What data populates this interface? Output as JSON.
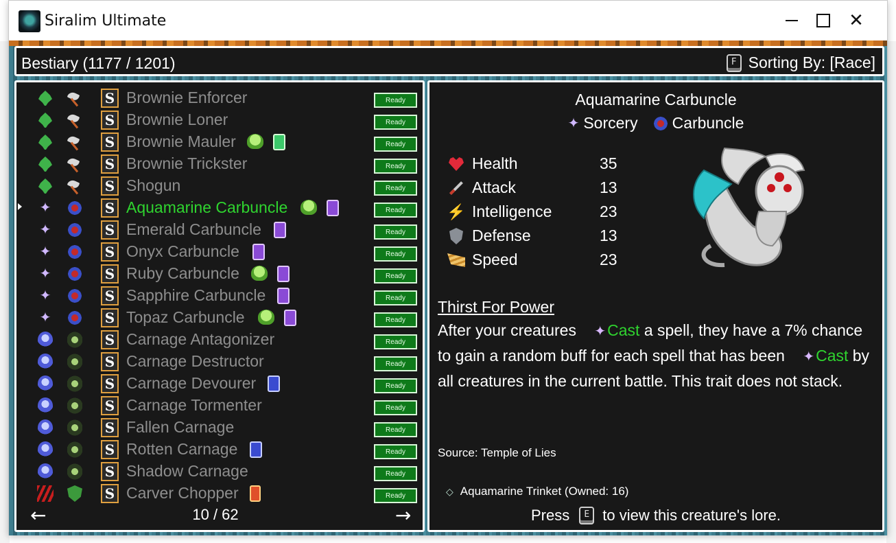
{
  "window": {
    "title": "Siralim Ultimate",
    "controls": {
      "minimize": "—",
      "maximize": "□",
      "close": "✕"
    }
  },
  "header": {
    "title": "Bestiary (1177 / 1201)",
    "sort_key": "F",
    "sort_label": "Sorting By: [Race]"
  },
  "list": {
    "status_label": "Ready",
    "selected_index": 5,
    "rows": [
      {
        "name": "Brownie Enforcer",
        "race_icon": "leaf-icon",
        "class_icon": "axe-icon",
        "extras": []
      },
      {
        "name": "Brownie Loner",
        "race_icon": "leaf-icon",
        "class_icon": "axe-icon",
        "extras": []
      },
      {
        "name": "Brownie Mauler",
        "race_icon": "leaf-icon",
        "class_icon": "axe-icon",
        "extras": [
          "blob-green-icon",
          "card-green-icon"
        ]
      },
      {
        "name": "Brownie Trickster",
        "race_icon": "leaf-icon",
        "class_icon": "axe-icon",
        "extras": []
      },
      {
        "name": "Shogun",
        "race_icon": "leaf-icon",
        "class_icon": "axe-icon",
        "extras": []
      },
      {
        "name": "Aquamarine Carbuncle",
        "race_icon": "sparkle-icon",
        "class_icon": "carbuncle-icon",
        "extras": [
          "blob-green-icon",
          "card-purple-icon"
        ]
      },
      {
        "name": "Emerald Carbuncle",
        "race_icon": "sparkle-icon",
        "class_icon": "carbuncle-icon",
        "extras": [
          "card-purple-icon"
        ]
      },
      {
        "name": "Onyx Carbuncle",
        "race_icon": "sparkle-icon",
        "class_icon": "carbuncle-icon",
        "extras": [
          "card-purple-icon"
        ]
      },
      {
        "name": "Ruby Carbuncle",
        "race_icon": "sparkle-icon",
        "class_icon": "carbuncle-icon",
        "extras": [
          "blob-green-icon",
          "card-purple-icon"
        ]
      },
      {
        "name": "Sapphire Carbuncle",
        "race_icon": "sparkle-icon",
        "class_icon": "carbuncle-icon",
        "extras": [
          "card-purple-icon"
        ]
      },
      {
        "name": "Topaz Carbuncle",
        "race_icon": "sparkle-icon",
        "class_icon": "carbuncle-icon",
        "extras": [
          "blob-green-icon",
          "card-purple-icon"
        ]
      },
      {
        "name": "Carnage Antagonizer",
        "race_icon": "skull-icon",
        "class_icon": "carnage-icon",
        "extras": []
      },
      {
        "name": "Carnage Destructor",
        "race_icon": "skull-icon",
        "class_icon": "carnage-icon",
        "extras": []
      },
      {
        "name": "Carnage Devourer",
        "race_icon": "skull-icon",
        "class_icon": "carnage-icon",
        "extras": [
          "card-blue-icon"
        ]
      },
      {
        "name": "Carnage Tormenter",
        "race_icon": "skull-icon",
        "class_icon": "carnage-icon",
        "extras": []
      },
      {
        "name": "Fallen Carnage",
        "race_icon": "skull-icon",
        "class_icon": "carnage-icon",
        "extras": []
      },
      {
        "name": "Rotten Carnage",
        "race_icon": "skull-icon",
        "class_icon": "carnage-icon",
        "extras": [
          "card-blue-icon"
        ]
      },
      {
        "name": "Shadow Carnage",
        "race_icon": "skull-icon",
        "class_icon": "carnage-icon",
        "extras": []
      },
      {
        "name": "Carver Chopper",
        "race_icon": "claw-icon",
        "class_icon": "shield-green-icon",
        "extras": [
          "card-red-icon"
        ]
      }
    ],
    "pager": {
      "prev": "←",
      "next": "→",
      "label": "10 / 62"
    }
  },
  "detail": {
    "name": "Aquamarine Carbuncle",
    "class_tag": "Sorcery",
    "race_tag": "Carbuncle",
    "stats": [
      {
        "label": "Health",
        "value": "35",
        "icon": "heart-icon"
      },
      {
        "label": "Attack",
        "value": "13",
        "icon": "sword-icon"
      },
      {
        "label": "Intelligence",
        "value": "23",
        "icon": "lightning-icon"
      },
      {
        "label": "Defense",
        "value": "13",
        "icon": "shield-icon"
      },
      {
        "label": "Speed",
        "value": "23",
        "icon": "wing-icon"
      }
    ],
    "trait": {
      "title": "Thirst For Power",
      "part1": "After your creatures",
      "cast1": "Cast",
      "part2": "a spell, they have a 7% chance to gain a random buff for each spell that has been",
      "cast2": "Cast",
      "part3": "by all creatures in the current battle. This trait does not stack."
    },
    "source": "Source: Temple of Lies",
    "trinket": "Aquamarine Trinket (Owned: 16)",
    "lore": {
      "press": "Press",
      "key": "E",
      "rest": "to view this creature's lore."
    }
  },
  "colors": {
    "panel_bg": "#181818",
    "selected_text": "#2fd42f",
    "normal_text": "#8e8e8e",
    "ready_bg": "#0e7a1a",
    "cast_text": "#2fd42f"
  }
}
